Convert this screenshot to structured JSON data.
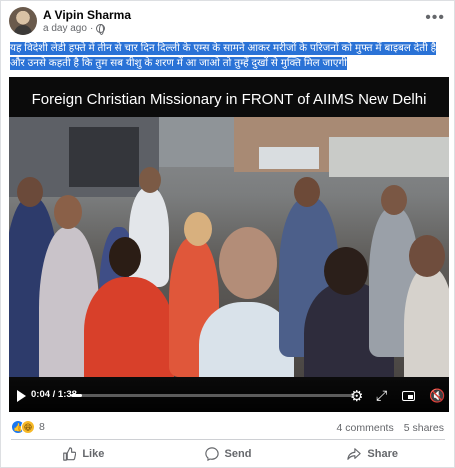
{
  "post": {
    "author": "A Vipin Sharma",
    "timestamp": "a day ago",
    "caption": "यह विदेशी लेडी हफ्ते में तीन से चार दिन दिल्ली के एम्स के सामने आकर मरीजों के परिजनों को मुफ्त में बाइबल देती है और उनसे कहती है कि तुम सब यीशु के शरण में आ जाओ तो तुम्हें दुखों से मुक्ति मिल जाएगी"
  },
  "video": {
    "title_overlay": "Foreign Christian Missionary in FRONT  of AIIMS New Delhi",
    "current_time": "0:04",
    "duration": "1:38",
    "time_display": "0:04 / 1:38",
    "progress_fraction": 0.04
  },
  "engagement": {
    "reaction_count": "8",
    "comments": "4 comments",
    "shares": "5 shares"
  },
  "actions": {
    "like_label": "Like",
    "send_label": "Send",
    "share_label": "Share"
  },
  "icons": {
    "more": "more-options-icon",
    "privacy": "globe-icon",
    "play": "play-icon",
    "settings": "gear-icon",
    "fullscreen": "fullscreen-icon",
    "pip": "picture-in-picture-icon",
    "volume": "volume-muted-icon"
  },
  "colors": {
    "accent": "#1877f2",
    "caption_highlight": "#2a72d6",
    "muted_text": "#65676b"
  }
}
